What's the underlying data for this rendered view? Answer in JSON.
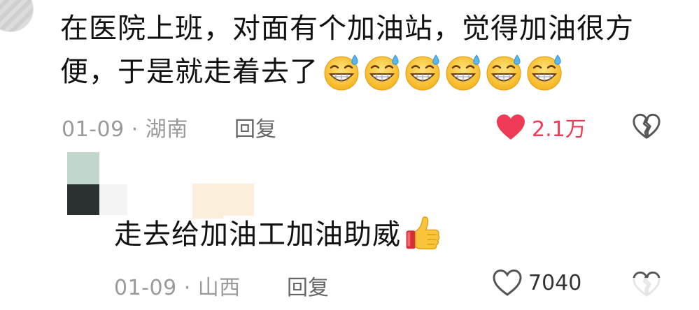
{
  "comments": [
    {
      "text_line1": "在医院上班，对面有个加油站，觉得加油很方",
      "text_line2": "便，于是就走着去了",
      "emoji_count": 6,
      "emoji": "sweat-grin-emoji",
      "date": "01-09",
      "separator": "·",
      "location": "湖南",
      "reply_label": "回复",
      "like_count": "2.1万",
      "liked": true,
      "like_color": "#ee3a55"
    },
    {
      "text": "走去给加油工加油助威",
      "emoji": "thumbs-up-emoji",
      "date": "01-09",
      "separator": "·",
      "location": "山西",
      "reply_label": "回复",
      "like_count": "7040",
      "liked": false
    }
  ]
}
